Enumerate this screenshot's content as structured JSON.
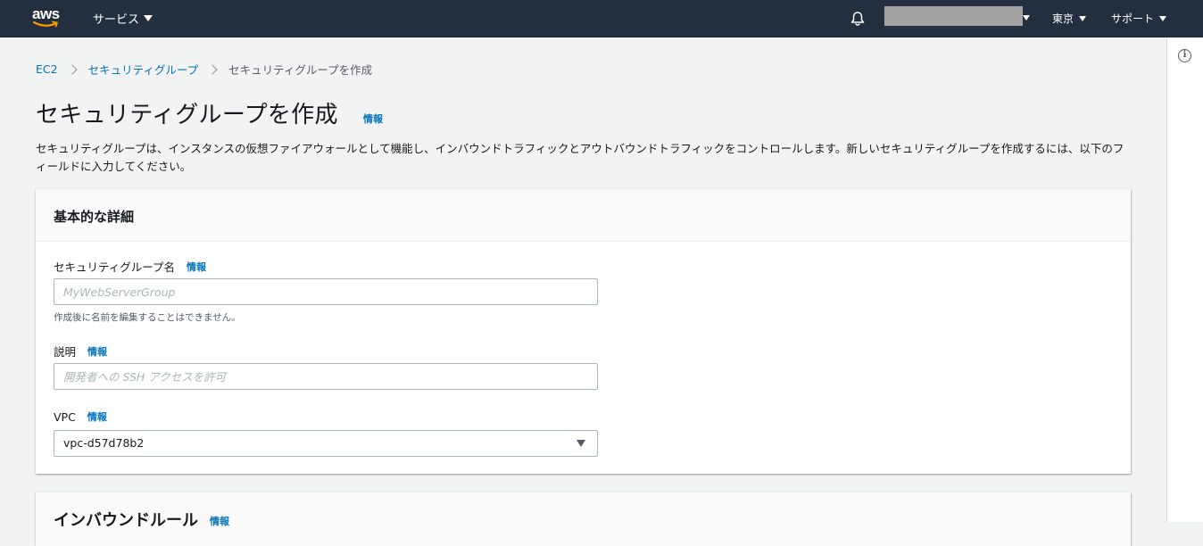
{
  "nav": {
    "logo_text": "aws",
    "services_label": "サービス",
    "region_label": "東京",
    "support_label": "サポート"
  },
  "breadcrumb": {
    "items": [
      "EC2",
      "セキュリティグループ",
      "セキュリティグループを作成"
    ]
  },
  "header": {
    "title": "セキュリティグループを作成",
    "info_label": "情報",
    "description": "セキュリティグループは、インスタンスの仮想ファイアウォールとして機能し、インバウンドトラフィックとアウトバウンドトラフィックをコントロールします。新しいセキュリティグループを作成するには、以下のフィールドに入力してください。"
  },
  "basic_details": {
    "title": "基本的な詳細",
    "name_field": {
      "label": "セキュリティグループ名",
      "info_label": "情報",
      "value": "",
      "placeholder": "MyWebServerGroup",
      "constraint": "作成後に名前を編集することはできません。"
    },
    "description_field": {
      "label": "説明",
      "info_label": "情報",
      "value": "",
      "placeholder": "開発者への SSH アクセスを許可"
    },
    "vpc_field": {
      "label": "VPC",
      "info_label": "情報",
      "selected": "vpc-d57d78b2"
    }
  },
  "inbound_rules": {
    "title": "インバウンドルール",
    "info_label": "情報"
  },
  "colors": {
    "nav_bg": "#232f3e",
    "link": "#0073bb",
    "page_bg": "#f2f3f3",
    "logo_smile": "#ff9900"
  },
  "icons": {
    "notifications": "bell-icon",
    "tools_info": "info-icon"
  }
}
